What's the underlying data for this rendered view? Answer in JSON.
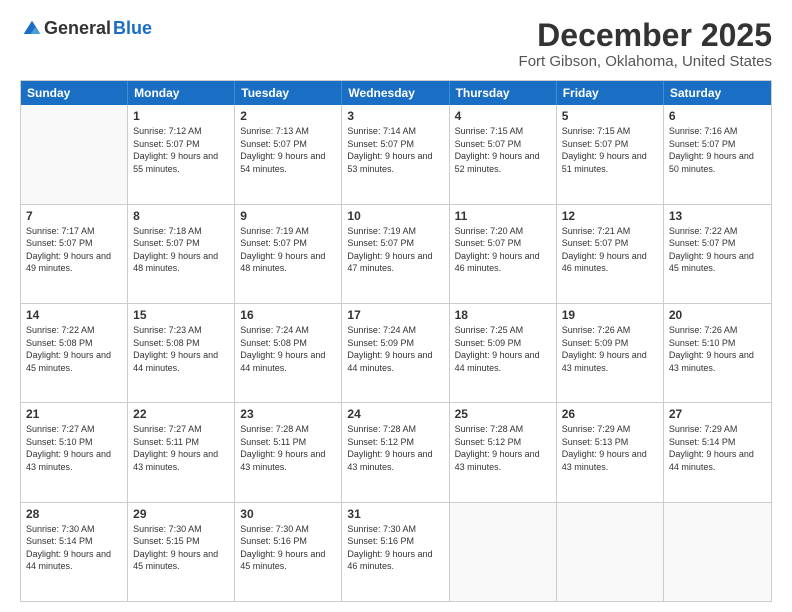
{
  "logo": {
    "general": "General",
    "blue": "Blue"
  },
  "title": "December 2025",
  "subtitle": "Fort Gibson, Oklahoma, United States",
  "weekdays": [
    "Sunday",
    "Monday",
    "Tuesday",
    "Wednesday",
    "Thursday",
    "Friday",
    "Saturday"
  ],
  "weeks": [
    [
      {
        "day": "",
        "sunrise": "",
        "sunset": "",
        "daylight": ""
      },
      {
        "day": "1",
        "sunrise": "Sunrise: 7:12 AM",
        "sunset": "Sunset: 5:07 PM",
        "daylight": "Daylight: 9 hours and 55 minutes."
      },
      {
        "day": "2",
        "sunrise": "Sunrise: 7:13 AM",
        "sunset": "Sunset: 5:07 PM",
        "daylight": "Daylight: 9 hours and 54 minutes."
      },
      {
        "day": "3",
        "sunrise": "Sunrise: 7:14 AM",
        "sunset": "Sunset: 5:07 PM",
        "daylight": "Daylight: 9 hours and 53 minutes."
      },
      {
        "day": "4",
        "sunrise": "Sunrise: 7:15 AM",
        "sunset": "Sunset: 5:07 PM",
        "daylight": "Daylight: 9 hours and 52 minutes."
      },
      {
        "day": "5",
        "sunrise": "Sunrise: 7:15 AM",
        "sunset": "Sunset: 5:07 PM",
        "daylight": "Daylight: 9 hours and 51 minutes."
      },
      {
        "day": "6",
        "sunrise": "Sunrise: 7:16 AM",
        "sunset": "Sunset: 5:07 PM",
        "daylight": "Daylight: 9 hours and 50 minutes."
      }
    ],
    [
      {
        "day": "7",
        "sunrise": "Sunrise: 7:17 AM",
        "sunset": "Sunset: 5:07 PM",
        "daylight": "Daylight: 9 hours and 49 minutes."
      },
      {
        "day": "8",
        "sunrise": "Sunrise: 7:18 AM",
        "sunset": "Sunset: 5:07 PM",
        "daylight": "Daylight: 9 hours and 48 minutes."
      },
      {
        "day": "9",
        "sunrise": "Sunrise: 7:19 AM",
        "sunset": "Sunset: 5:07 PM",
        "daylight": "Daylight: 9 hours and 48 minutes."
      },
      {
        "day": "10",
        "sunrise": "Sunrise: 7:19 AM",
        "sunset": "Sunset: 5:07 PM",
        "daylight": "Daylight: 9 hours and 47 minutes."
      },
      {
        "day": "11",
        "sunrise": "Sunrise: 7:20 AM",
        "sunset": "Sunset: 5:07 PM",
        "daylight": "Daylight: 9 hours and 46 minutes."
      },
      {
        "day": "12",
        "sunrise": "Sunrise: 7:21 AM",
        "sunset": "Sunset: 5:07 PM",
        "daylight": "Daylight: 9 hours and 46 minutes."
      },
      {
        "day": "13",
        "sunrise": "Sunrise: 7:22 AM",
        "sunset": "Sunset: 5:07 PM",
        "daylight": "Daylight: 9 hours and 45 minutes."
      }
    ],
    [
      {
        "day": "14",
        "sunrise": "Sunrise: 7:22 AM",
        "sunset": "Sunset: 5:08 PM",
        "daylight": "Daylight: 9 hours and 45 minutes."
      },
      {
        "day": "15",
        "sunrise": "Sunrise: 7:23 AM",
        "sunset": "Sunset: 5:08 PM",
        "daylight": "Daylight: 9 hours and 44 minutes."
      },
      {
        "day": "16",
        "sunrise": "Sunrise: 7:24 AM",
        "sunset": "Sunset: 5:08 PM",
        "daylight": "Daylight: 9 hours and 44 minutes."
      },
      {
        "day": "17",
        "sunrise": "Sunrise: 7:24 AM",
        "sunset": "Sunset: 5:09 PM",
        "daylight": "Daylight: 9 hours and 44 minutes."
      },
      {
        "day": "18",
        "sunrise": "Sunrise: 7:25 AM",
        "sunset": "Sunset: 5:09 PM",
        "daylight": "Daylight: 9 hours and 44 minutes."
      },
      {
        "day": "19",
        "sunrise": "Sunrise: 7:26 AM",
        "sunset": "Sunset: 5:09 PM",
        "daylight": "Daylight: 9 hours and 43 minutes."
      },
      {
        "day": "20",
        "sunrise": "Sunrise: 7:26 AM",
        "sunset": "Sunset: 5:10 PM",
        "daylight": "Daylight: 9 hours and 43 minutes."
      }
    ],
    [
      {
        "day": "21",
        "sunrise": "Sunrise: 7:27 AM",
        "sunset": "Sunset: 5:10 PM",
        "daylight": "Daylight: 9 hours and 43 minutes."
      },
      {
        "day": "22",
        "sunrise": "Sunrise: 7:27 AM",
        "sunset": "Sunset: 5:11 PM",
        "daylight": "Daylight: 9 hours and 43 minutes."
      },
      {
        "day": "23",
        "sunrise": "Sunrise: 7:28 AM",
        "sunset": "Sunset: 5:11 PM",
        "daylight": "Daylight: 9 hours and 43 minutes."
      },
      {
        "day": "24",
        "sunrise": "Sunrise: 7:28 AM",
        "sunset": "Sunset: 5:12 PM",
        "daylight": "Daylight: 9 hours and 43 minutes."
      },
      {
        "day": "25",
        "sunrise": "Sunrise: 7:28 AM",
        "sunset": "Sunset: 5:12 PM",
        "daylight": "Daylight: 9 hours and 43 minutes."
      },
      {
        "day": "26",
        "sunrise": "Sunrise: 7:29 AM",
        "sunset": "Sunset: 5:13 PM",
        "daylight": "Daylight: 9 hours and 43 minutes."
      },
      {
        "day": "27",
        "sunrise": "Sunrise: 7:29 AM",
        "sunset": "Sunset: 5:14 PM",
        "daylight": "Daylight: 9 hours and 44 minutes."
      }
    ],
    [
      {
        "day": "28",
        "sunrise": "Sunrise: 7:30 AM",
        "sunset": "Sunset: 5:14 PM",
        "daylight": "Daylight: 9 hours and 44 minutes."
      },
      {
        "day": "29",
        "sunrise": "Sunrise: 7:30 AM",
        "sunset": "Sunset: 5:15 PM",
        "daylight": "Daylight: 9 hours and 45 minutes."
      },
      {
        "day": "30",
        "sunrise": "Sunrise: 7:30 AM",
        "sunset": "Sunset: 5:16 PM",
        "daylight": "Daylight: 9 hours and 45 minutes."
      },
      {
        "day": "31",
        "sunrise": "Sunrise: 7:30 AM",
        "sunset": "Sunset: 5:16 PM",
        "daylight": "Daylight: 9 hours and 46 minutes."
      },
      {
        "day": "",
        "sunrise": "",
        "sunset": "",
        "daylight": ""
      },
      {
        "day": "",
        "sunrise": "",
        "sunset": "",
        "daylight": ""
      },
      {
        "day": "",
        "sunrise": "",
        "sunset": "",
        "daylight": ""
      }
    ]
  ]
}
